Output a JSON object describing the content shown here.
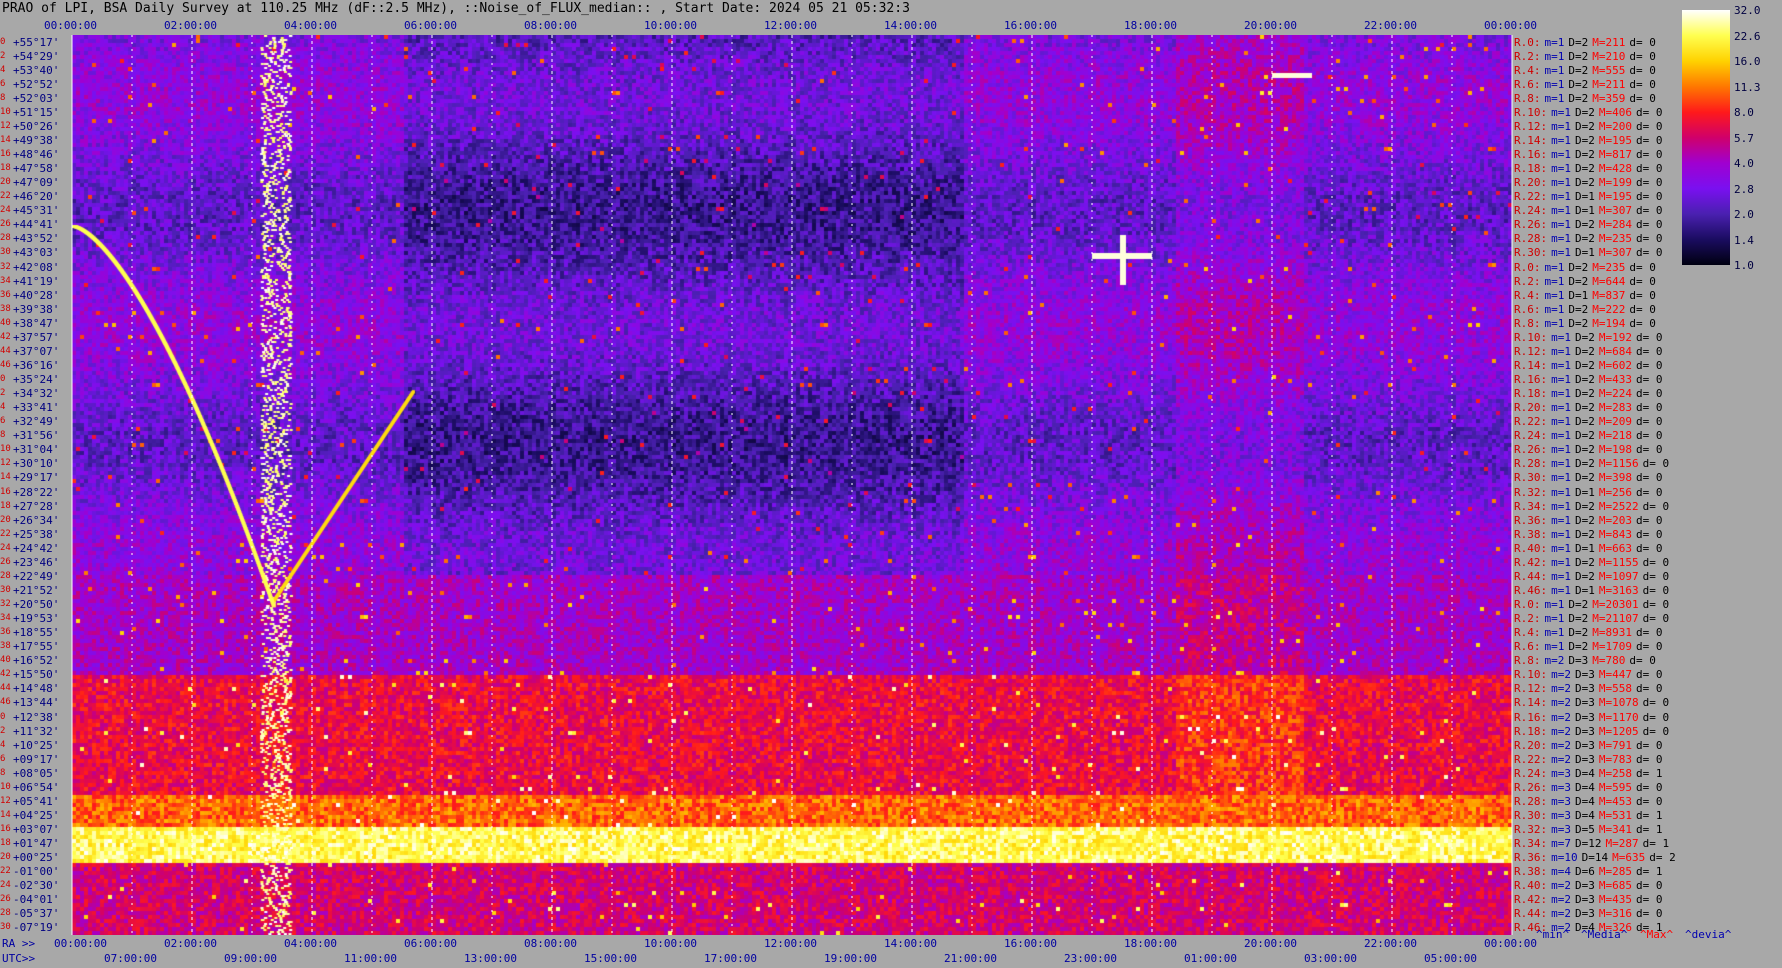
{
  "title": "PRAO of LPI, BSA Daily Survey at 110.25 MHz (dF::2.5 MHz), ::Noise_of_FLUX_median:: , Start Date: 2024 05 21 05:32:3",
  "ra_prefix": "RA >>",
  "utc_prefix": "UTC>>",
  "footer_tags": [
    {
      "text": "^min^",
      "color": "#0000b0"
    },
    {
      "text": "^Media^",
      "color": "#0000b0"
    },
    {
      "text": "^Max^",
      "color": "#ff0000"
    },
    {
      "text": "^devia^",
      "color": "#0000b0"
    }
  ],
  "chart_data": {
    "type": "heatmap",
    "title": "PRAO of LPI, BSA Daily Survey at 110.25 MHz (dF::2.5 MHz), ::Noise_of_FLUX_median:: , Start Date: 2024 05 21 05:32:3",
    "x_ra_ticks": [
      "00:00:00",
      "02:00:00",
      "04:00:00",
      "06:00:00",
      "08:00:00",
      "10:00:00",
      "12:00:00",
      "14:00:00",
      "16:00:00",
      "18:00:00",
      "20:00:00",
      "22:00:00",
      "00:00:00"
    ],
    "x_utc_ticks": [
      "07:00:00",
      "09:00:00",
      "11:00:00",
      "13:00:00",
      "15:00:00",
      "17:00:00",
      "19:00:00",
      "21:00:00",
      "23:00:00",
      "01:00:00",
      "03:00:00",
      "05:00:00"
    ],
    "y_row_index": [
      "0",
      "2",
      "4",
      "6",
      "8",
      "10",
      "12",
      "14",
      "16",
      "18",
      "20",
      "22",
      "24",
      "26",
      "28",
      "30",
      "32",
      "34",
      "36",
      "38",
      "40",
      "42",
      "44",
      "46",
      "0",
      "2",
      "4",
      "6",
      "8",
      "10",
      "12",
      "14",
      "16",
      "18",
      "20",
      "22",
      "24",
      "26",
      "28",
      "30",
      "32",
      "34",
      "36",
      "38",
      "40",
      "42",
      "44",
      "46",
      "0",
      "2",
      "4",
      "6",
      "8",
      "10",
      "12",
      "14",
      "16",
      "18",
      "20",
      "22",
      "24",
      "26",
      "28",
      "30",
      "32",
      "34",
      "36",
      "38",
      "40",
      "42",
      "44",
      "46"
    ],
    "y_declination_ticks": [
      "+55°17'",
      "+54°29'",
      "+53°40'",
      "+52°52'",
      "+52°03'",
      "+51°15'",
      "+50°26'",
      "+49°38'",
      "+48°46'",
      "+47°58'",
      "+47°09'",
      "+46°20'",
      "+45°31'",
      "+44°41'",
      "+43°52'",
      "+43°03'",
      "+42°08'",
      "+41°19'",
      "+40°28'",
      "+39°38'",
      "+38°47'",
      "+37°57'",
      "+37°07'",
      "+36°16'",
      "+35°24'",
      "+34°32'",
      "+33°41'",
      "+32°49'",
      "+31°56'",
      "+31°04'",
      "+30°10'",
      "+29°17'",
      "+28°22'",
      "+27°28'",
      "+26°34'",
      "+25°38'",
      "+24°42'",
      "+23°46'",
      "+22°49'",
      "+21°52'",
      "+20°50'",
      "+19°53'",
      "+18°55'",
      "+17°55'",
      "+16°52'",
      "+15°50'",
      "+14°48'",
      "+13°44'",
      "+12°38'",
      "+11°32'",
      "+10°25'",
      "+09°17'",
      "+08°05'",
      "+06°54'",
      "+05°41'",
      "+04°25'",
      "+03°07'",
      "+01°47'",
      "+00°25'",
      "-01°00'",
      "-02°30'",
      "-04°01'",
      "-05°37'",
      "-07°19'"
    ],
    "colorbar": {
      "ticks": [
        "32.0",
        "22.6",
        "16.0",
        "11.3",
        "8.0",
        "5.7",
        "4.0",
        "2.8",
        "2.0",
        "1.4",
        "1.0"
      ],
      "colors": [
        "#ffffff",
        "#ffff50",
        "#ffd200",
        "#ff7800",
        "#ff1a1a",
        "#d0006a",
        "#a000d0",
        "#7a10f0",
        "#4a20b0",
        "#1a0c60",
        "#000010"
      ]
    },
    "stats_rows": [
      [
        "R.0:",
        "m=1",
        "D=2",
        "M=211",
        "d= 0"
      ],
      [
        "R.2:",
        "m=1",
        "D=2",
        "M=210",
        "d= 0"
      ],
      [
        "R.4:",
        "m=1",
        "D=2",
        "M=555",
        "d= 0"
      ],
      [
        "R.6:",
        "m=1",
        "D=2",
        "M=211",
        "d= 0"
      ],
      [
        "R.8:",
        "m=1",
        "D=2",
        "M=359",
        "d= 0"
      ],
      [
        "R.10:",
        "m=1",
        "D=2",
        "M=406",
        "d= 0"
      ],
      [
        "R.12:",
        "m=1",
        "D=2",
        "M=200",
        "d= 0"
      ],
      [
        "R.14:",
        "m=1",
        "D=2",
        "M=195",
        "d= 0"
      ],
      [
        "R.16:",
        "m=1",
        "D=2",
        "M=817",
        "d= 0"
      ],
      [
        "R.18:",
        "m=1",
        "D=2",
        "M=428",
        "d= 0"
      ],
      [
        "R.20:",
        "m=1",
        "D=2",
        "M=199",
        "d= 0"
      ],
      [
        "R.22:",
        "m=1",
        "D=1",
        "M=195",
        "d= 0"
      ],
      [
        "R.24:",
        "m=1",
        "D=1",
        "M=307",
        "d= 0"
      ],
      [
        "R.26:",
        "m=1",
        "D=2",
        "M=284",
        "d= 0"
      ],
      [
        "R.28:",
        "m=1",
        "D=2",
        "M=235",
        "d= 0"
      ],
      [
        "R.30:",
        "m=1",
        "D=1",
        "M=307",
        "d= 0"
      ],
      [
        "R.0:",
        "m=1",
        "D=2",
        "M=235",
        "d= 0"
      ],
      [
        "R.2:",
        "m=1",
        "D=2",
        "M=644",
        "d= 0"
      ],
      [
        "R.4:",
        "m=1",
        "D=1",
        "M=837",
        "d= 0"
      ],
      [
        "R.6:",
        "m=1",
        "D=2",
        "M=222",
        "d= 0"
      ],
      [
        "R.8:",
        "m=1",
        "D=2",
        "M=194",
        "d= 0"
      ],
      [
        "R.10:",
        "m=1",
        "D=2",
        "M=192",
        "d= 0"
      ],
      [
        "R.12:",
        "m=1",
        "D=2",
        "M=684",
        "d= 0"
      ],
      [
        "R.14:",
        "m=1",
        "D=2",
        "M=602",
        "d= 0"
      ],
      [
        "R.16:",
        "m=1",
        "D=2",
        "M=433",
        "d= 0"
      ],
      [
        "R.18:",
        "m=1",
        "D=2",
        "M=224",
        "d= 0"
      ],
      [
        "R.20:",
        "m=1",
        "D=2",
        "M=283",
        "d= 0"
      ],
      [
        "R.22:",
        "m=1",
        "D=2",
        "M=209",
        "d= 0"
      ],
      [
        "R.24:",
        "m=1",
        "D=2",
        "M=218",
        "d= 0"
      ],
      [
        "R.26:",
        "m=1",
        "D=2",
        "M=198",
        "d= 0"
      ],
      [
        "R.28:",
        "m=1",
        "D=2",
        "M=1156",
        "d= 0"
      ],
      [
        "R.30:",
        "m=1",
        "D=2",
        "M=398",
        "d= 0"
      ],
      [
        "R.32:",
        "m=1",
        "D=1",
        "M=256",
        "d= 0"
      ],
      [
        "R.34:",
        "m=1",
        "D=2",
        "M=2522",
        "d= 0"
      ],
      [
        "R.36:",
        "m=1",
        "D=2",
        "M=203",
        "d= 0"
      ],
      [
        "R.38:",
        "m=1",
        "D=2",
        "M=843",
        "d= 0"
      ],
      [
        "R.40:",
        "m=1",
        "D=1",
        "M=663",
        "d= 0"
      ],
      [
        "R.42:",
        "m=1",
        "D=2",
        "M=1155",
        "d= 0"
      ],
      [
        "R.44:",
        "m=1",
        "D=2",
        "M=1097",
        "d= 0"
      ],
      [
        "R.46:",
        "m=1",
        "D=1",
        "M=3163",
        "d= 0"
      ],
      [
        "R.0:",
        "m=1",
        "D=2",
        "M=20301",
        "d= 0"
      ],
      [
        "R.2:",
        "m=1",
        "D=2",
        "M=21107",
        "d= 0"
      ],
      [
        "R.4:",
        "m=1",
        "D=2",
        "M=8931",
        "d= 0"
      ],
      [
        "R.6:",
        "m=1",
        "D=2",
        "M=1709",
        "d= 0"
      ],
      [
        "R.8:",
        "m=2",
        "D=3",
        "M=780",
        "d= 0"
      ],
      [
        "R.10:",
        "m=2",
        "D=3",
        "M=447",
        "d= 0"
      ],
      [
        "R.12:",
        "m=2",
        "D=3",
        "M=558",
        "d= 0"
      ],
      [
        "R.14:",
        "m=2",
        "D=3",
        "M=1078",
        "d= 0"
      ],
      [
        "R.16:",
        "m=2",
        "D=3",
        "M=1170",
        "d= 0"
      ],
      [
        "R.18:",
        "m=2",
        "D=3",
        "M=1205",
        "d= 0"
      ],
      [
        "R.20:",
        "m=2",
        "D=3",
        "M=791",
        "d= 0"
      ],
      [
        "R.22:",
        "m=2",
        "D=3",
        "M=783",
        "d= 0"
      ],
      [
        "R.24:",
        "m=3",
        "D=4",
        "M=258",
        "d= 1"
      ],
      [
        "R.26:",
        "m=3",
        "D=4",
        "M=595",
        "d= 0"
      ],
      [
        "R.28:",
        "m=3",
        "D=4",
        "M=453",
        "d= 0"
      ],
      [
        "R.30:",
        "m=3",
        "D=4",
        "M=531",
        "d= 1"
      ],
      [
        "R.32:",
        "m=3",
        "D=5",
        "M=341",
        "d= 1"
      ],
      [
        "R.34:",
        "m=7",
        "D=12",
        "M=287",
        "d= 1"
      ],
      [
        "R.36:",
        "m=10",
        "D=14",
        "M=635",
        "d= 2"
      ],
      [
        "R.38:",
        "m=4",
        "D=6",
        "M=285",
        "d= 1"
      ],
      [
        "R.40:",
        "m=2",
        "D=3",
        "M=685",
        "d= 0"
      ],
      [
        "R.42:",
        "m=2",
        "D=3",
        "M=435",
        "d= 0"
      ],
      [
        "R.44:",
        "m=2",
        "D=3",
        "M=316",
        "d= 0"
      ],
      [
        "R.46:",
        "m=2",
        "D=4",
        "M=326",
        "d= 1"
      ]
    ]
  }
}
